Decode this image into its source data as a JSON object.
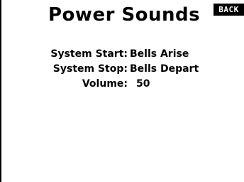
{
  "screen": {
    "title": "Power Sounds",
    "back_label": "BACK"
  },
  "settings": [
    {
      "label": "System Start:",
      "value": "Bells Arise"
    },
    {
      "label": "System Stop:",
      "value": "Bells Depart"
    },
    {
      "label": "Volume:",
      "value": "50"
    }
  ]
}
